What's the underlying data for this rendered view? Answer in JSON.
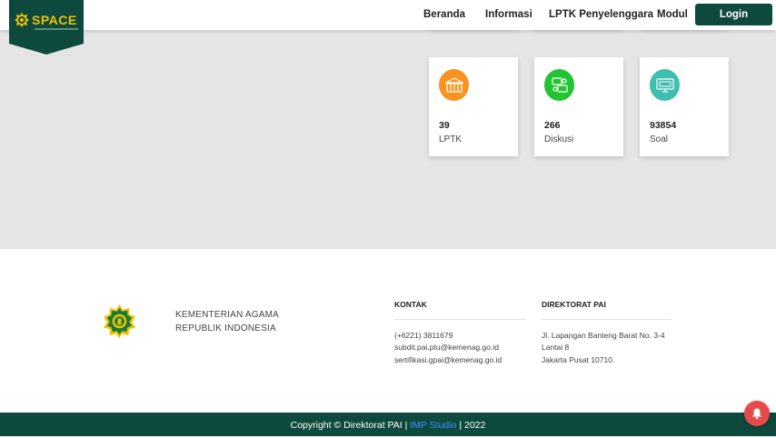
{
  "colors": {
    "brand_dark_green": "#0d4a3d",
    "logo_yellow": "#f2c200",
    "lptk_icon": "#f7931e",
    "diskusi_icon": "#21c531",
    "soal_icon": "#3fbfb0",
    "link_blue": "#3f8cff",
    "notification_red": "#e54b4d"
  },
  "navbar": {
    "logo_text": "SPACE",
    "logo_icon": "kemenag-emblem-icon",
    "items": [
      {
        "label": "Beranda"
      },
      {
        "label": "Informasi"
      },
      {
        "label": "LPTK Penyelenggara"
      },
      {
        "label": "Modul"
      }
    ],
    "login_label": "Login"
  },
  "stats": [
    {
      "value": "39",
      "label": "LPTK",
      "icon": "building-icon"
    },
    {
      "value": "266",
      "label": "Diskusi",
      "icon": "discussion-icon"
    },
    {
      "value": "93854",
      "label": "Soal",
      "icon": "monitor-icon"
    }
  ],
  "footer": {
    "org": {
      "emblem_icon": "kemenag-emblem-icon",
      "line1": "KEMENTERIAN AGAMA",
      "line2": "REPUBLIK INDONESIA"
    },
    "contact": {
      "title": "KONTAK",
      "lines": [
        "(+6221) 3811679",
        "subdit.pai.ptu@kemenag.go.id",
        "sertifikasi.gpai@kemenag.go.id"
      ]
    },
    "directorate": {
      "title": "DIREKTORAT PAI",
      "lines": [
        "Jl. Lapangan Banteng Barat No. 3-4",
        "Lantai 8",
        "Jakarta Pusat 10710."
      ]
    }
  },
  "bottom_bar": {
    "prefix": "Copyright © Direktorat PAI |",
    "link": "IMP Studio",
    "suffix": "| 2022"
  },
  "notification_icon": "bell-icon"
}
